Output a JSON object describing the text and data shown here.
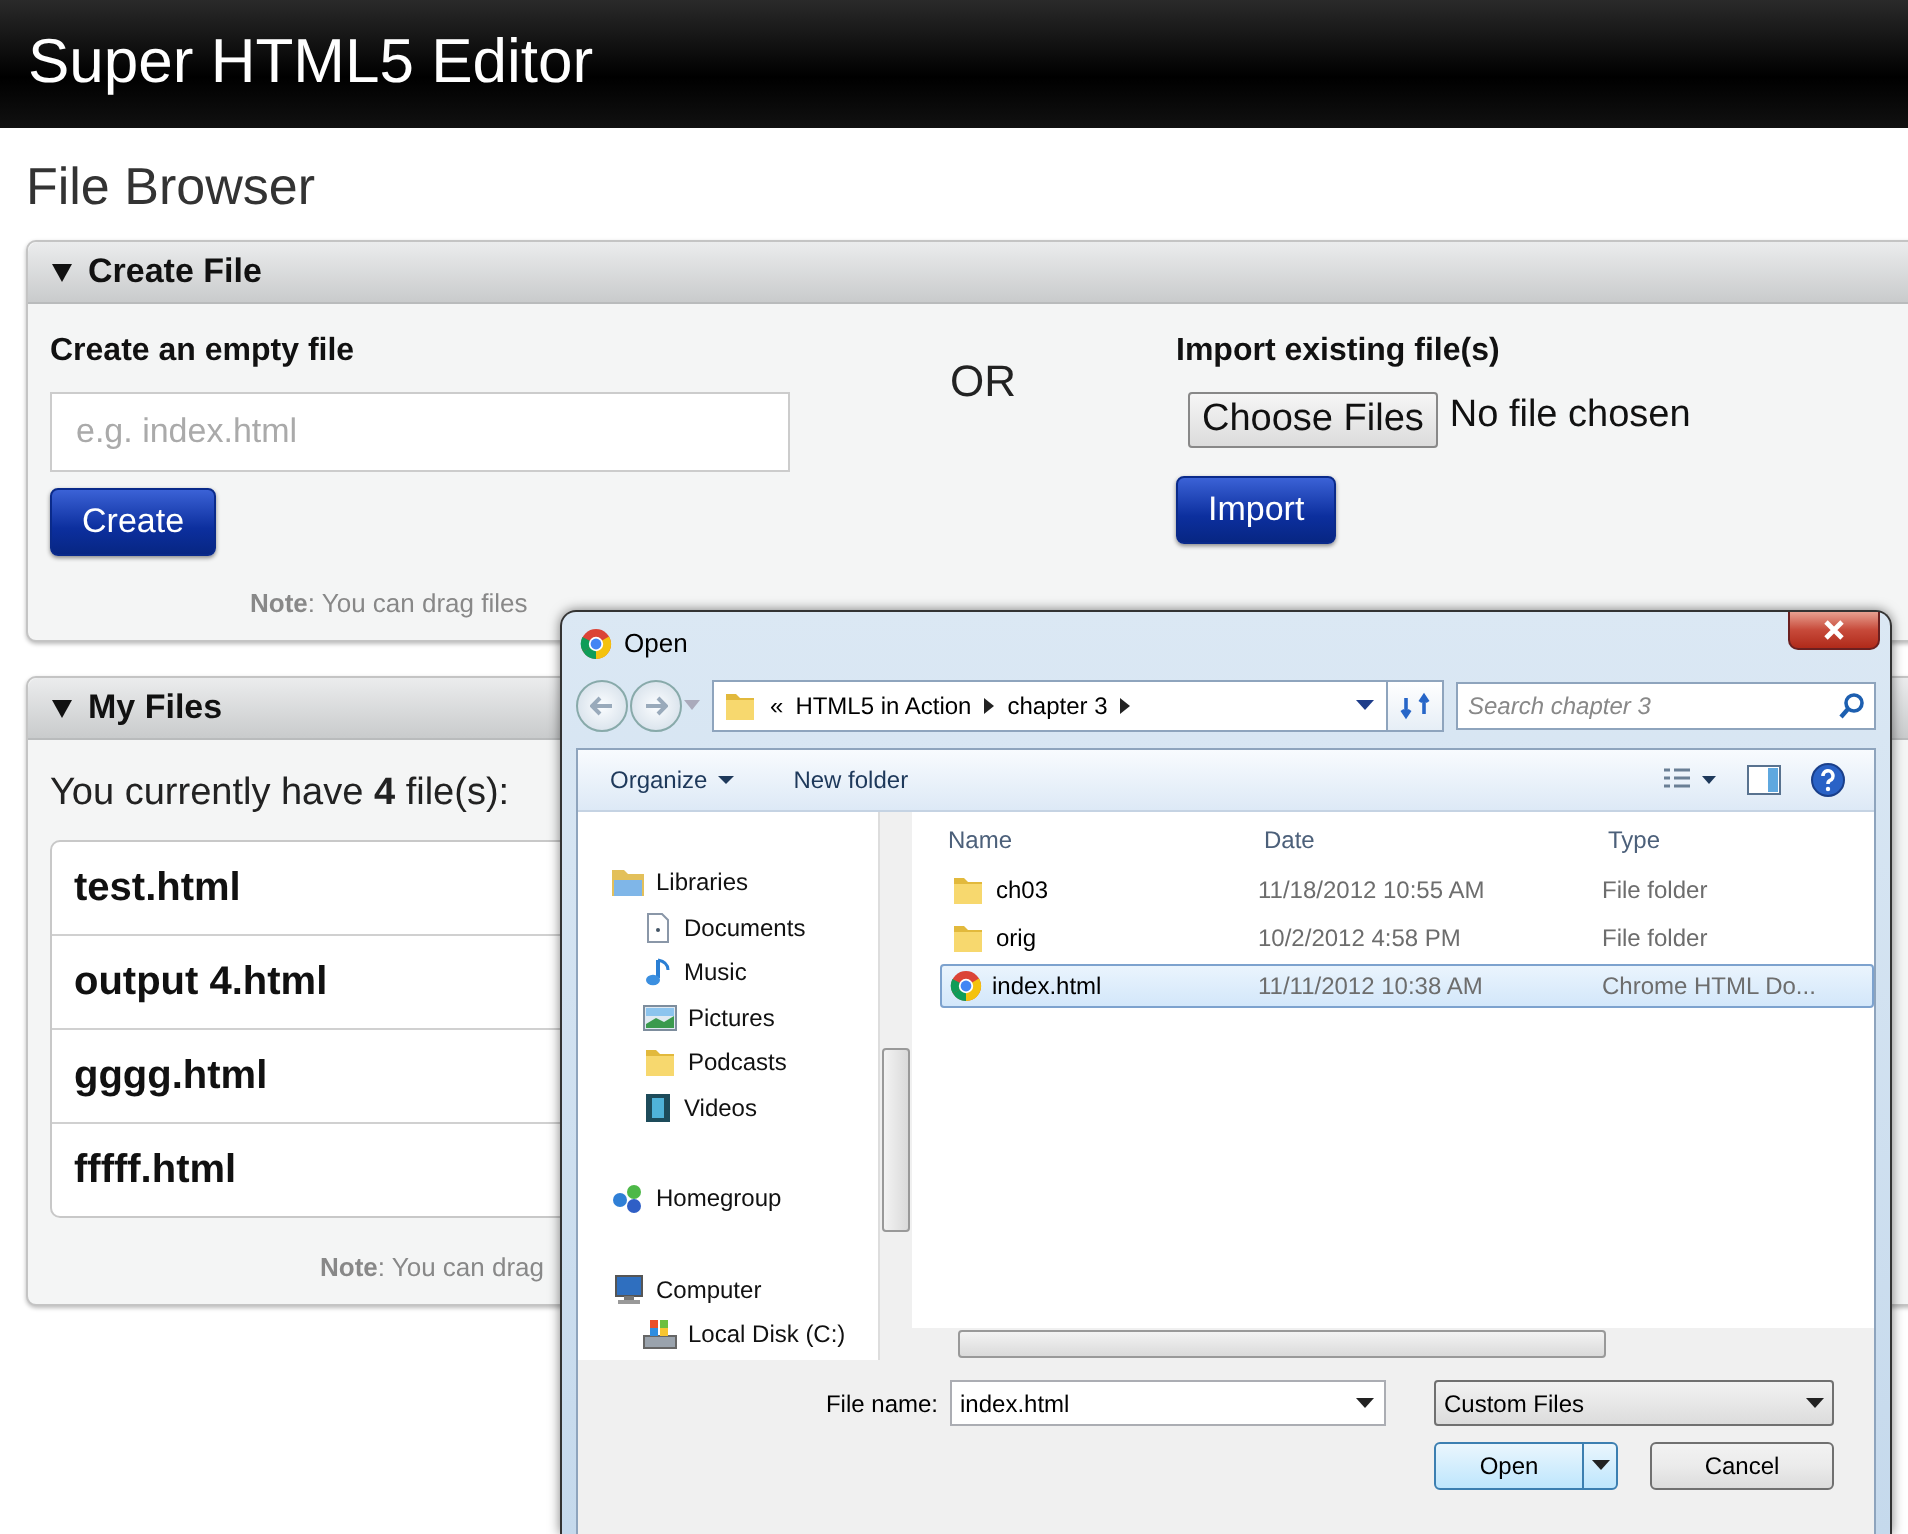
{
  "app": {
    "title": "Super HTML5 Editor"
  },
  "page_title": "File Browser",
  "create_panel": {
    "title": "Create File",
    "expanded": true,
    "create": {
      "heading": "Create an empty file",
      "placeholder": "e.g. index.html",
      "button": "Create"
    },
    "separator": "OR",
    "import": {
      "heading": "Import existing file(s)",
      "choose_button": "Choose Files",
      "status": "No file chosen",
      "button": "Import"
    },
    "note": "**Note**: You can drag files"
  },
  "files_panel": {
    "title": "My Files",
    "expanded": true,
    "summary": "You currently have **4** file(s):",
    "files": [
      "test.html",
      "output 4.html",
      "gggg.html",
      "fffff.html"
    ],
    "note": "**Note**: You can drag"
  },
  "dialog": {
    "title": "Open",
    "breadcrumb_prefix": "«",
    "breadcrumb": [
      "HTML5 in Action",
      "chapter 3"
    ],
    "search_placeholder": "Search chapter 3",
    "toolbar": [
      "Organize",
      "New folder"
    ],
    "nav": [
      {
        "label": "Libraries",
        "kind": "libraries",
        "children": [
          {
            "label": "Documents",
            "kind": "documents"
          },
          {
            "label": "Music",
            "kind": "music"
          },
          {
            "label": "Pictures",
            "kind": "pictures"
          },
          {
            "label": "Podcasts",
            "kind": "podcasts"
          },
          {
            "label": "Videos",
            "kind": "videos"
          }
        ]
      },
      {
        "label": "Homegroup",
        "kind": "homegroup"
      },
      {
        "label": "Computer",
        "kind": "computer",
        "children": [
          {
            "label": "Local Disk (C:)",
            "kind": "disk"
          }
        ]
      }
    ],
    "columns": [
      "Name",
      "Date",
      "Type"
    ],
    "files": [
      {
        "name": "ch03",
        "date": "11/18/2012 10:55 AM",
        "type": "File folder",
        "kind": "folder",
        "selected": false
      },
      {
        "name": "orig",
        "date": "10/2/2012 4:58 PM",
        "type": "File folder",
        "kind": "folder",
        "selected": false
      },
      {
        "name": "index.html",
        "date": "11/11/2012 10:38 AM",
        "type": "Chrome HTML Do...",
        "kind": "chrome",
        "selected": true
      }
    ],
    "file_name_label": "File name:",
    "file_name": "index.html",
    "file_type": "Custom Files",
    "buttons": [
      "Open",
      "Cancel"
    ]
  }
}
